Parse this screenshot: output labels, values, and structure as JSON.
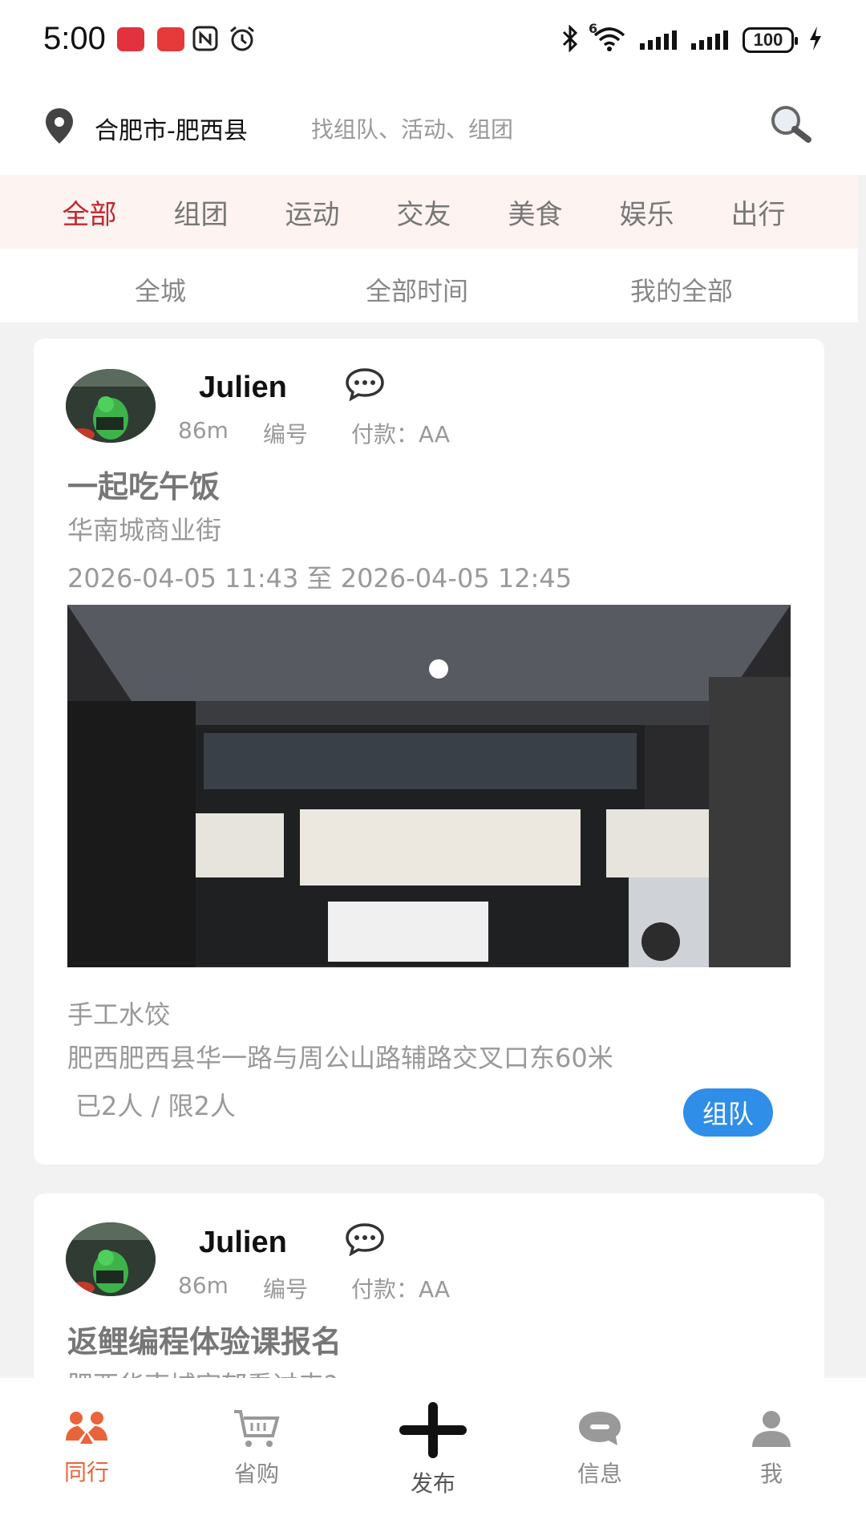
{
  "status_bar": {
    "time": "5:00",
    "battery": "100",
    "network_sup": "6",
    "icons": [
      "app-icon-red",
      "huawei-icon",
      "nfc-icon",
      "alarm-icon",
      "bluetooth-icon",
      "wifi-icon",
      "signal-icon",
      "signal-icon",
      "battery-icon",
      "charging-icon"
    ]
  },
  "header": {
    "city": "合肥市-肥西县",
    "search_placeholder": "找组队、活动、组团"
  },
  "categories": [
    "全部",
    "组团",
    "运动",
    "交友",
    "美食",
    "娱乐",
    "出行"
  ],
  "active_category": "全部",
  "filters": [
    "全城",
    "全部时间",
    "我的全部"
  ],
  "posts": [
    {
      "user": "Julien",
      "distance": "86m",
      "number_label": "编号",
      "payment": "付款：AA",
      "title": "一起吃午饭",
      "place": "华南城商业街",
      "time": "2026-04-05 11:43 至 2026-04-05 12:45",
      "desc": "手工水饺",
      "address": "肥西肥西县华一路与周公山路辅路交叉口东60米",
      "count": "已2人 / 限2人",
      "action": "组队"
    },
    {
      "user": "Julien",
      "distance": "86m",
      "number_label": "编号",
      "payment": "付款：AA",
      "title": "返鲤编程体验课报名",
      "place": "肥西华南城宇郁看过来?"
    }
  ],
  "bottom_nav": [
    {
      "label": "同行",
      "icon": "group-icon"
    },
    {
      "label": "省购",
      "icon": "cart-icon"
    },
    {
      "label": "发布",
      "icon": "plus-icon"
    },
    {
      "label": "信息",
      "icon": "message-icon"
    },
    {
      "label": "我",
      "icon": "user-icon"
    }
  ],
  "colors": {
    "accent_red": "#c0272d",
    "nav_active": "#e8643a",
    "join_button": "#2f8ee8",
    "tab_bg": "#fdf3f1"
  }
}
